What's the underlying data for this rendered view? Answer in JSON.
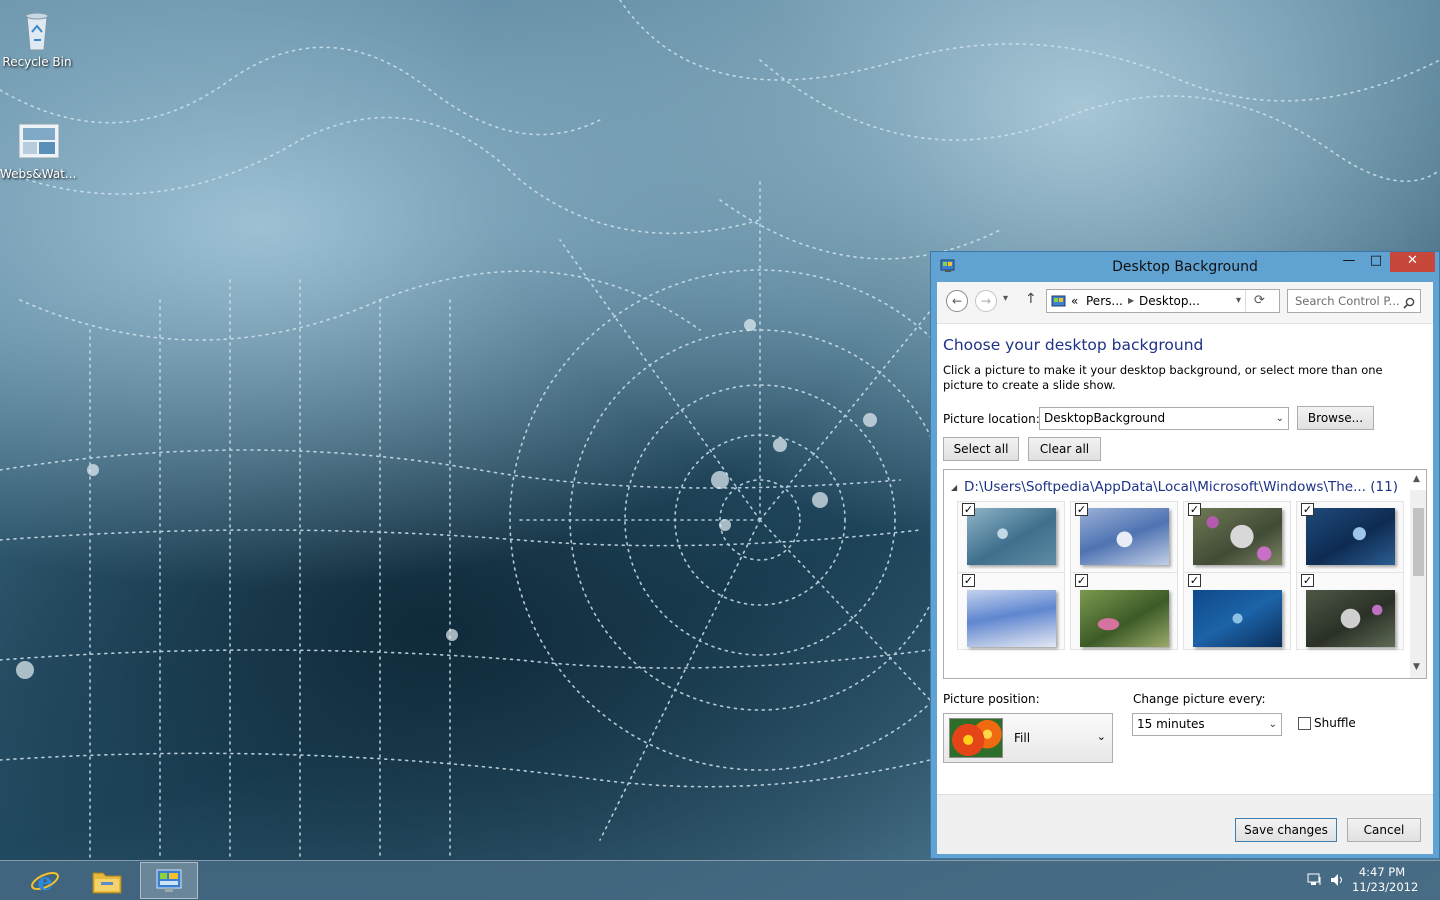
{
  "desktop": {
    "icons": [
      {
        "label": "Recycle Bin",
        "icon": "recycle-bin-icon"
      },
      {
        "label": "Webs&Wat...",
        "icon": "theme-file-icon"
      }
    ]
  },
  "window": {
    "title": "Desktop Background",
    "controls": {
      "minimize": "—",
      "maximize": "□",
      "close": "✕"
    },
    "nav": {
      "back": "←",
      "forward": "→",
      "recent": "▾",
      "up": "↑",
      "breadcrumb_sep": "«",
      "crumbs": [
        "Pers...",
        "Desktop..."
      ],
      "refresh": "⟳",
      "search_placeholder": "Search Control P..."
    },
    "heading": "Choose your desktop background",
    "description": "Click a picture to make it your desktop background, or select more than one picture to create a slide show.",
    "picture_location_label": "Picture location:",
    "picture_location_value": "DesktopBackground",
    "browse_label": "Browse...",
    "select_all_label": "Select all",
    "clear_all_label": "Clear all",
    "folder_path": "D:\\Users\\Softpedia\\AppData\\Local\\Microsoft\\Windows\\The... (11)",
    "thumbnails": [
      {
        "checked": true,
        "name": "web-dew-blue-1"
      },
      {
        "checked": true,
        "name": "web-dew-blue-2"
      },
      {
        "checked": true,
        "name": "web-flower-purple"
      },
      {
        "checked": true,
        "name": "web-dark-blue"
      },
      {
        "checked": true,
        "name": "web-light-blue"
      },
      {
        "checked": true,
        "name": "web-green-foxglove"
      },
      {
        "checked": true,
        "name": "web-deep-blue"
      },
      {
        "checked": true,
        "name": "web-green-grey"
      }
    ],
    "picture_position_label": "Picture position:",
    "picture_position_value": "Fill",
    "change_every_label": "Change picture every:",
    "change_every_value": "15 minutes",
    "shuffle_label": "Shuffle",
    "shuffle_checked": false,
    "save_label": "Save changes",
    "cancel_label": "Cancel"
  },
  "taskbar": {
    "apps": [
      {
        "name": "Internet Explorer",
        "icon": "internet-explorer-icon"
      },
      {
        "name": "File Explorer",
        "icon": "file-explorer-icon"
      },
      {
        "name": "Control Panel",
        "icon": "control-panel-icon",
        "active": true
      }
    ],
    "tray": {
      "network": "network-icon",
      "volume": "volume-icon"
    },
    "time": "4:47 PM",
    "date": "11/23/2012"
  }
}
